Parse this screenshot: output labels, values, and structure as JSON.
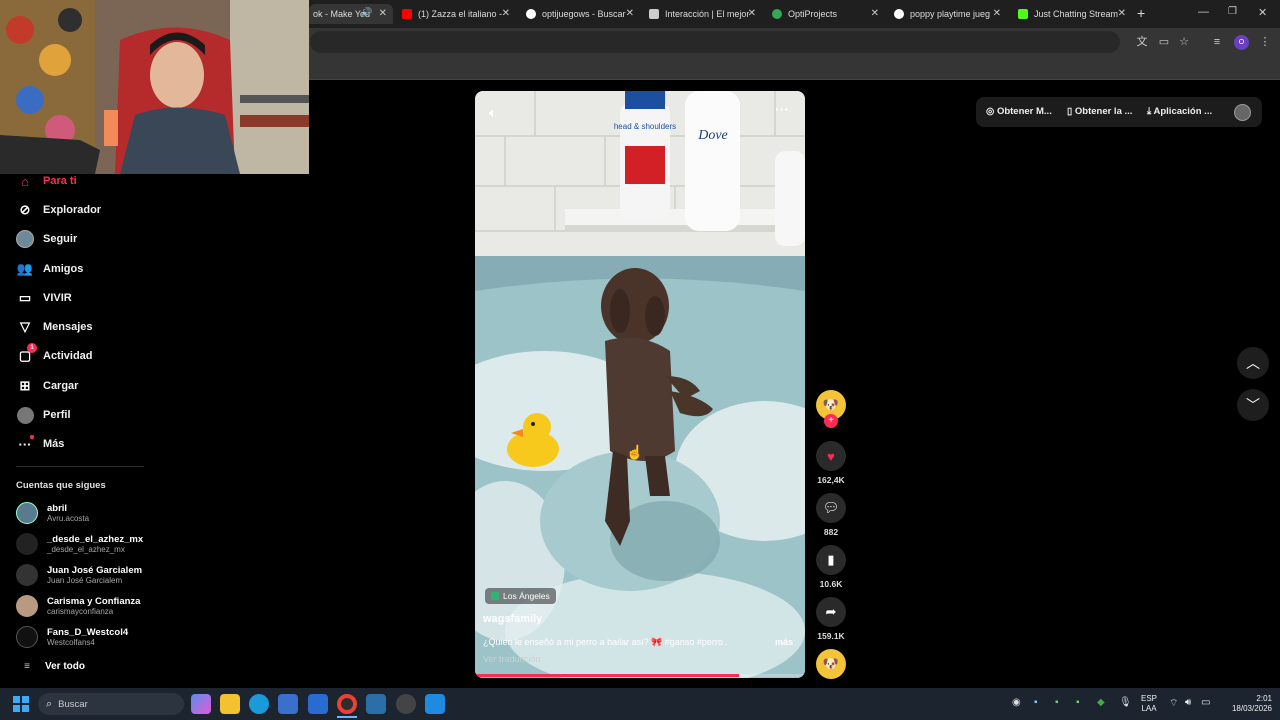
{
  "browser": {
    "tabs": [
      {
        "title": "ok - Make You",
        "color": "#222222"
      },
      {
        "title": "(1) Zazza el italiano -",
        "color": "#ff0000"
      },
      {
        "title": "optijuegows - Buscar",
        "color": "#4285f4"
      },
      {
        "title": "Interacción | El mejor",
        "color": "#666666"
      },
      {
        "title": "OptiProjects",
        "color": "#35a853"
      },
      {
        "title": "poppy playtime jueg",
        "color": "#4285f4"
      },
      {
        "title": "Just Chatting Stream",
        "color": "#53fc18"
      }
    ],
    "new_tab": "+",
    "profile_letter": "O"
  },
  "sidebar": {
    "items": [
      {
        "label": "Para ti",
        "icon": "home-icon"
      },
      {
        "label": "Explorador",
        "icon": "compass-icon"
      },
      {
        "label": "Seguir",
        "icon": "avatar"
      },
      {
        "label": "Amigos",
        "icon": "friends-icon"
      },
      {
        "label": "VIVIR",
        "icon": "live-icon"
      },
      {
        "label": "Mensajes",
        "icon": "send-icon"
      },
      {
        "label": "Actividad",
        "icon": "activity-icon",
        "badge": "1"
      },
      {
        "label": "Cargar",
        "icon": "upload-icon"
      },
      {
        "label": "Perfil",
        "icon": "profile-icon"
      },
      {
        "label": "Más",
        "icon": "more-icon"
      }
    ],
    "following_title": "Cuentas que sigues",
    "accounts": [
      {
        "name": "abril",
        "user": "Avru.acosta"
      },
      {
        "name": "_desde_el_azhez_mx",
        "user": "_desde_el_azhez_mx"
      },
      {
        "name": "Juan José Garcialem",
        "user": "Juan José Garcialem"
      },
      {
        "name": "Carisma y Confianza",
        "user": "carismayconfianza"
      },
      {
        "name": "Fans_D_Westcol4",
        "user": "Westcolfans4"
      }
    ],
    "see_all": "Ver todo"
  },
  "video": {
    "location": "Los Ángeles",
    "author": "wagsfamily",
    "caption": "¿Quién le enseñó a mi perro a bailar así? 🎀 #ganso #perro ...",
    "more": "más",
    "translate": "Ver traducción",
    "bottle1_brand": "head & shoulders",
    "bottle2_brand": "Dove",
    "progress": 0.8
  },
  "actions": {
    "likes": "162,4K",
    "comments": "882",
    "saves": "10.6K",
    "shares": "159.1K"
  },
  "topbar": {
    "pill1": "Obtener M...",
    "pill2": "Obtener la ...",
    "pill3": "Aplicación ..."
  },
  "taskbar": {
    "search": "Buscar",
    "lang1": "ESP",
    "lang2": "LAA",
    "time": "2:01",
    "date": "18/03/2026"
  }
}
